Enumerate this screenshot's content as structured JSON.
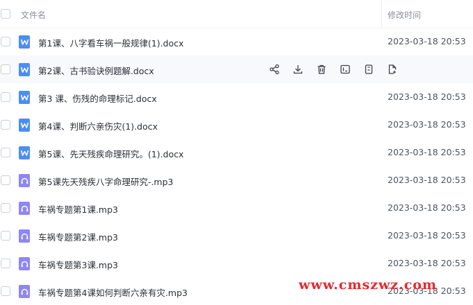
{
  "header": {
    "name_label": "文件名",
    "time_label": "修改时间"
  },
  "files": [
    {
      "name": "第1课、八字看车祸一般规律(1).docx",
      "time": "2023-03-18 20:53",
      "type": "doc"
    },
    {
      "name": "第2课、古书验诀例题解.docx",
      "time": "",
      "type": "doc"
    },
    {
      "name": "第3 课、伤残的命理标记.docx",
      "time": "2023-03-18 20:53",
      "type": "doc"
    },
    {
      "name": "第4课、判断六亲伤灾(1).docx",
      "time": "2023-03-18 20:53",
      "type": "doc"
    },
    {
      "name": "第5课、先天残疾命理研究。(1).docx",
      "time": "2023-03-18 20:53",
      "type": "doc"
    },
    {
      "name": "第5课先天残疾八字命理研究-.mp3",
      "time": "2023-03-18 20:53",
      "type": "audio"
    },
    {
      "name": "车祸专题第1课.mp3",
      "time": "2023-03-18 20:53",
      "type": "audio"
    },
    {
      "name": "车祸专题第2课.mp3",
      "time": "2023-03-18 20:53",
      "type": "audio"
    },
    {
      "name": "车祸专题第3课.mp3",
      "time": "2023-03-18 20:53",
      "type": "audio"
    },
    {
      "name": "车祸专题第4课如何判断六亲有灾.mp3",
      "time": "2023-03-18 20:53",
      "type": "audio"
    }
  ],
  "hover_actions": [
    "share-icon",
    "download-icon",
    "delete-icon",
    "rename-icon",
    "copy-icon",
    "move-icon"
  ],
  "watermark": "www.cmszwz.com",
  "colors": {
    "doc": "#4a8ef4",
    "audio": "#8e86f5",
    "watermark": "#e4292d"
  }
}
